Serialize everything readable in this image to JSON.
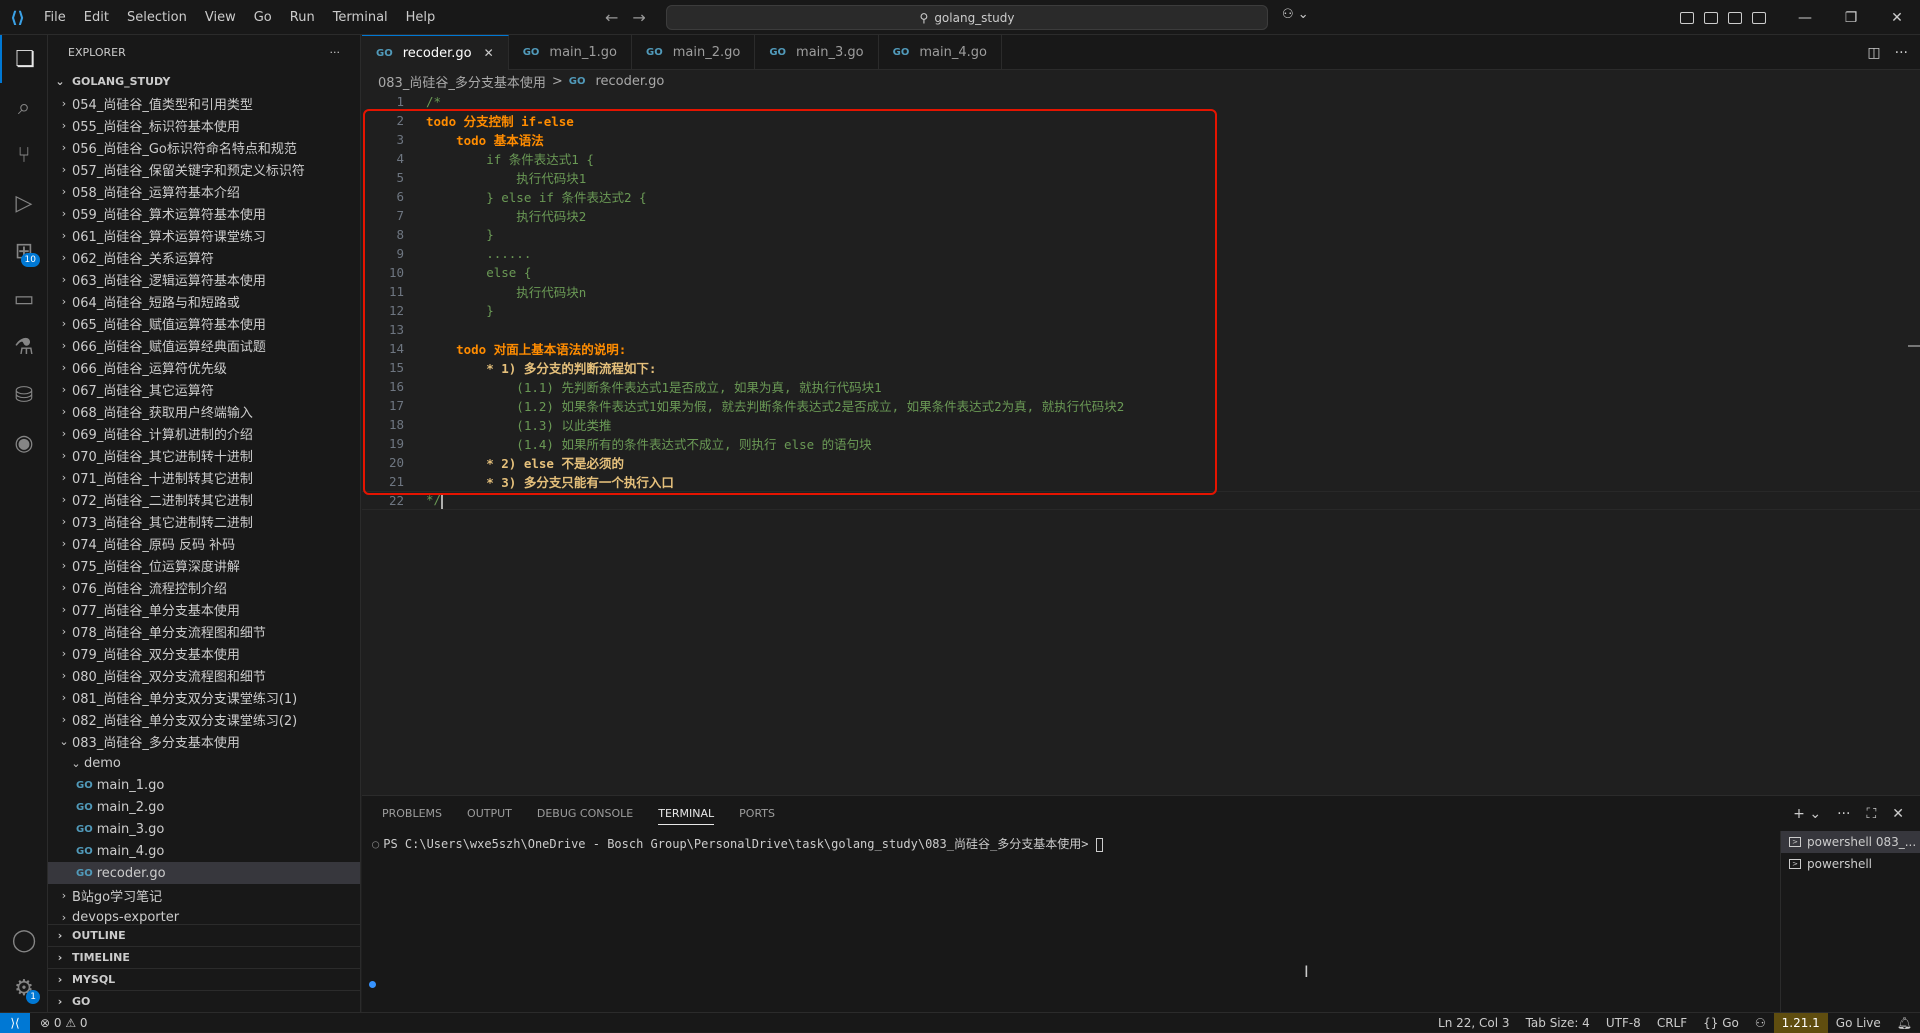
{
  "menu": [
    "File",
    "Edit",
    "Selection",
    "View",
    "Go",
    "Run",
    "Terminal",
    "Help"
  ],
  "search": {
    "text": "golang_study"
  },
  "explorer": {
    "title": "EXPLORER",
    "root": "GOLANG_STUDY",
    "items": [
      {
        "label": "054_尚硅谷_值类型和引用类型",
        "kind": "folder"
      },
      {
        "label": "055_尚硅谷_标识符基本使用",
        "kind": "folder"
      },
      {
        "label": "056_尚硅谷_Go标识符命名特点和规范",
        "kind": "folder"
      },
      {
        "label": "057_尚硅谷_保留关键字和预定义标识符",
        "kind": "folder"
      },
      {
        "label": "058_尚硅谷_运算符基本介绍",
        "kind": "folder"
      },
      {
        "label": "059_尚硅谷_算术运算符基本使用",
        "kind": "folder"
      },
      {
        "label": "061_尚硅谷_算术运算符课堂练习",
        "kind": "folder"
      },
      {
        "label": "062_尚硅谷_关系运算符",
        "kind": "folder"
      },
      {
        "label": "063_尚硅谷_逻辑运算符基本使用",
        "kind": "folder"
      },
      {
        "label": "064_尚硅谷_短路与和短路或",
        "kind": "folder"
      },
      {
        "label": "065_尚硅谷_赋值运算符基本使用",
        "kind": "folder"
      },
      {
        "label": "066_尚硅谷_赋值运算经典面试题",
        "kind": "folder"
      },
      {
        "label": "066_尚硅谷_运算符优先级",
        "kind": "folder"
      },
      {
        "label": "067_尚硅谷_其它运算符",
        "kind": "folder"
      },
      {
        "label": "068_尚硅谷_获取用户终端输入",
        "kind": "folder"
      },
      {
        "label": "069_尚硅谷_计算机进制的介绍",
        "kind": "folder"
      },
      {
        "label": "070_尚硅谷_其它进制转十进制",
        "kind": "folder"
      },
      {
        "label": "071_尚硅谷_十进制转其它进制",
        "kind": "folder"
      },
      {
        "label": "072_尚硅谷_二进制转其它进制",
        "kind": "folder"
      },
      {
        "label": "073_尚硅谷_其它进制转二进制",
        "kind": "folder"
      },
      {
        "label": "074_尚硅谷_原码 反码 补码",
        "kind": "folder"
      },
      {
        "label": "075_尚硅谷_位运算深度讲解",
        "kind": "folder"
      },
      {
        "label": "076_尚硅谷_流程控制介绍",
        "kind": "folder"
      },
      {
        "label": "077_尚硅谷_单分支基本使用",
        "kind": "folder"
      },
      {
        "label": "078_尚硅谷_单分支流程图和细节",
        "kind": "folder"
      },
      {
        "label": "079_尚硅谷_双分支基本使用",
        "kind": "folder"
      },
      {
        "label": "080_尚硅谷_双分支流程图和细节",
        "kind": "folder"
      },
      {
        "label": "081_尚硅谷_单分支双分支课堂练习(1)",
        "kind": "folder"
      },
      {
        "label": "082_尚硅谷_单分支双分支课堂练习(2)",
        "kind": "folder"
      },
      {
        "label": "083_尚硅谷_多分支基本使用",
        "kind": "open-folder"
      },
      {
        "label": "demo",
        "kind": "open-subfolder"
      },
      {
        "label": "main_1.go",
        "kind": "file-deep"
      },
      {
        "label": "main_2.go",
        "kind": "file-deep"
      },
      {
        "label": "main_3.go",
        "kind": "file-deep"
      },
      {
        "label": "main_4.go",
        "kind": "file-deep"
      },
      {
        "label": "recoder.go",
        "kind": "file-selected"
      },
      {
        "label": "B站go学习笔记",
        "kind": "folder"
      },
      {
        "label": "devops-exporter",
        "kind": "folder"
      }
    ],
    "sections": [
      "OUTLINE",
      "TIMELINE",
      "MYSQL",
      "GO"
    ]
  },
  "tabs": [
    {
      "label": "recoder.go",
      "active": true
    },
    {
      "label": "main_1.go",
      "active": false
    },
    {
      "label": "main_2.go",
      "active": false
    },
    {
      "label": "main_3.go",
      "active": false
    },
    {
      "label": "main_4.go",
      "active": false
    }
  ],
  "breadcrumb": {
    "folder": "083_尚硅谷_多分支基本使用",
    "sep": ">",
    "file": "recoder.go"
  },
  "code": [
    {
      "n": "1",
      "parts": [
        {
          "t": "/*",
          "c": "comment"
        }
      ]
    },
    {
      "n": "2",
      "parts": [
        {
          "t": "todo 分支控制 if-else",
          "c": "todo"
        }
      ]
    },
    {
      "n": "3",
      "parts": [
        {
          "t": "    ",
          "c": "comment"
        },
        {
          "t": "todo 基本语法",
          "c": "todo"
        }
      ]
    },
    {
      "n": "4",
      "parts": [
        {
          "t": "        if 条件表达式1 {",
          "c": "comment"
        }
      ]
    },
    {
      "n": "5",
      "parts": [
        {
          "t": "            执行代码块1",
          "c": "comment"
        }
      ]
    },
    {
      "n": "6",
      "parts": [
        {
          "t": "        } else if 条件表达式2 {",
          "c": "comment"
        }
      ]
    },
    {
      "n": "7",
      "parts": [
        {
          "t": "            执行代码块2",
          "c": "comment"
        }
      ]
    },
    {
      "n": "8",
      "parts": [
        {
          "t": "        }",
          "c": "comment"
        }
      ]
    },
    {
      "n": "9",
      "parts": [
        {
          "t": "        ......",
          "c": "comment"
        }
      ]
    },
    {
      "n": "10",
      "parts": [
        {
          "t": "        else {",
          "c": "comment"
        }
      ]
    },
    {
      "n": "11",
      "parts": [
        {
          "t": "            执行代码块n",
          "c": "comment"
        }
      ]
    },
    {
      "n": "12",
      "parts": [
        {
          "t": "        }",
          "c": "comment"
        }
      ]
    },
    {
      "n": "13",
      "parts": [
        {
          "t": "",
          "c": "comment"
        }
      ]
    },
    {
      "n": "14",
      "parts": [
        {
          "t": "    ",
          "c": "comment"
        },
        {
          "t": "todo 对面上基本语法的说明:",
          "c": "todo"
        }
      ]
    },
    {
      "n": "15",
      "parts": [
        {
          "t": "        ",
          "c": "comment"
        },
        {
          "t": "* 1) 多分支的判断流程如下:",
          "c": "bold"
        }
      ]
    },
    {
      "n": "16",
      "parts": [
        {
          "t": "            (1.1) 先判断条件表达式1是否成立, 如果为真, 就执行代码块1",
          "c": "comment"
        }
      ]
    },
    {
      "n": "17",
      "parts": [
        {
          "t": "            (1.2) 如果条件表达式1如果为假, 就去判断条件表达式2是否成立, 如果条件表达式2为真, 就执行代码块2",
          "c": "comment"
        }
      ]
    },
    {
      "n": "18",
      "parts": [
        {
          "t": "            (1.3) 以此类推",
          "c": "comment"
        }
      ]
    },
    {
      "n": "19",
      "parts": [
        {
          "t": "            (1.4) 如果所有的条件表达式不成立, 则执行 else 的语句块",
          "c": "comment"
        }
      ]
    },
    {
      "n": "20",
      "parts": [
        {
          "t": "        ",
          "c": "comment"
        },
        {
          "t": "* 2) else 不是必须的",
          "c": "bold"
        }
      ]
    },
    {
      "n": "21",
      "parts": [
        {
          "t": "        ",
          "c": "comment"
        },
        {
          "t": "* 3) 多分支只能有一个执行入口",
          "c": "bold"
        }
      ]
    },
    {
      "n": "22",
      "parts": [
        {
          "t": "*/",
          "c": "comment"
        }
      ]
    }
  ],
  "panel": {
    "tabs": [
      "PROBLEMS",
      "OUTPUT",
      "DEBUG CONSOLE",
      "TERMINAL",
      "PORTS"
    ],
    "active_tab": "TERMINAL",
    "prompt": "PS C:\\Users\\wxe5szh\\OneDrive - Bosch Group\\PersonalDrive\\task\\golang_study\\083_尚硅谷_多分支基本使用>",
    "terminals": [
      "powershell 083_...",
      "powershell"
    ]
  },
  "status": {
    "problems": "⊗ 0 ⚠ 0",
    "position": "Ln 22, Col 3",
    "tab_size": "Tab Size: 4",
    "encoding": "UTF-8",
    "eol": "CRLF",
    "language": "{} Go",
    "go_version": "1.21.1",
    "go_live": "Go Live"
  },
  "activity_badges": {
    "extensions": "10",
    "accounts_settings": "1"
  },
  "colors": {
    "accent": "#0078d4",
    "todo": "#ff8c00",
    "comment": "#6a9955",
    "highlight_box": "#e51400"
  }
}
